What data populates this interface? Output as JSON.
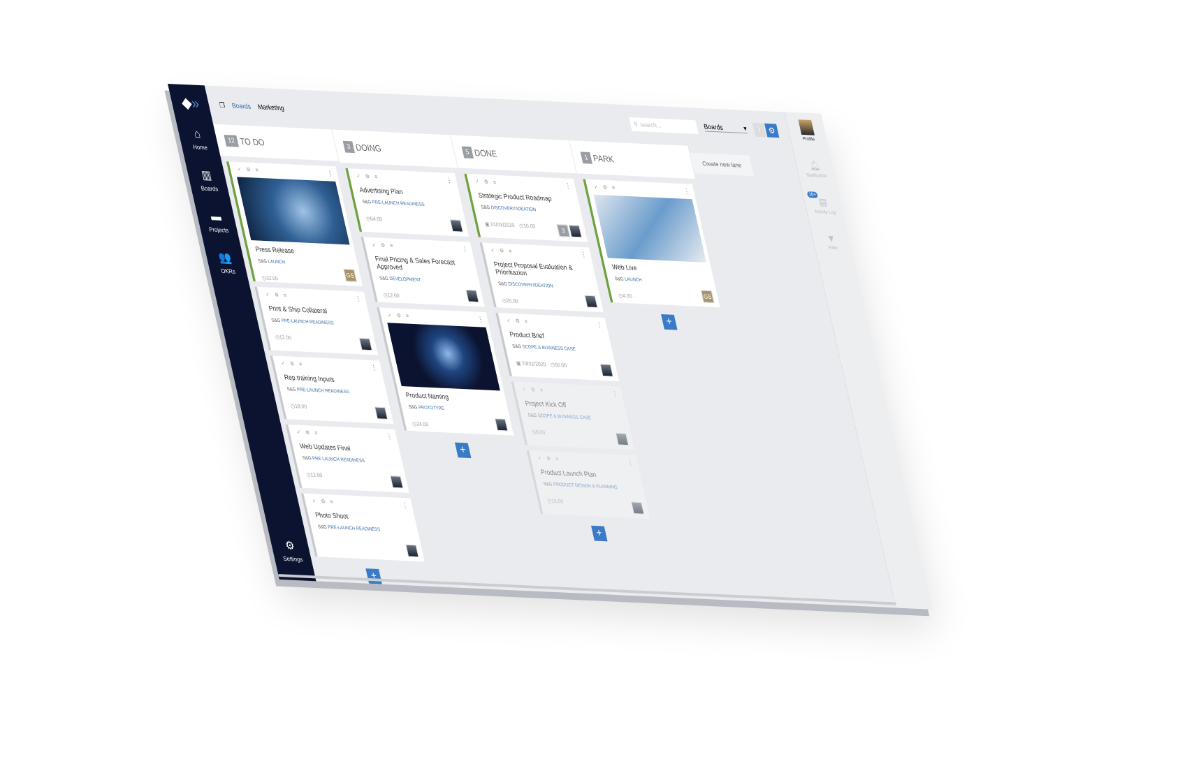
{
  "sidebar": {
    "items": [
      {
        "label": "Home",
        "icon": "home-icon"
      },
      {
        "label": "Boards",
        "icon": "boards-icon"
      },
      {
        "label": "Projects",
        "icon": "folder-icon"
      },
      {
        "label": "OKRs",
        "icon": "people-icon"
      }
    ],
    "settings": "Settings"
  },
  "breadcrumb": {
    "root": "Boards",
    "current": "Marketing"
  },
  "search": {
    "placeholder": "search..."
  },
  "board_select": {
    "value": "Boards"
  },
  "lanes": [
    {
      "count": "12",
      "name": "TO DO",
      "cards": [
        {
          "title": "Press Release",
          "prefix": "S&G",
          "tag": "LAUNCH",
          "time": "32.00",
          "avatar": "GS",
          "image": "tech",
          "green": true
        },
        {
          "title": "Print & Ship Collateral",
          "prefix": "S&G",
          "tag": "PRE-LAUNCH READINESS",
          "time": "12.00"
        },
        {
          "title": "Rep training Inputs",
          "prefix": "S&G",
          "tag": "PRE-LAUNCH READINESS",
          "time": "18.00"
        },
        {
          "title": "Web Updates Final",
          "prefix": "S&G",
          "tag": "PRE-LAUNCH READINESS",
          "time": "12.00"
        },
        {
          "title": "Photo Shoot",
          "prefix": "S&G",
          "tag": "PRE-LAUNCH READINESS",
          "time": ""
        }
      ]
    },
    {
      "count": "3",
      "name": "DOING",
      "cards": [
        {
          "title": "Advertising Plan",
          "prefix": "S&G",
          "tag": "PRE-LAUNCH READINESS",
          "time": "64.00",
          "green": true
        },
        {
          "title": "Final Pricing & Sales Forecast Approved",
          "prefix": "S&G",
          "tag": "DEVELOPMENT",
          "time": "12.00"
        },
        {
          "title": "Product Naming",
          "prefix": "S&G",
          "tag": "PROTOTYPE",
          "time": "24.00",
          "image": "butterfly"
        }
      ]
    },
    {
      "count": "5",
      "name": "DONE",
      "cards": [
        {
          "title": "Strategic Product Roadmap",
          "prefix": "S&G",
          "tag": "DISCOVERY/IDEATION",
          "date": "01/03/2020",
          "time": "10.00",
          "extra": "3",
          "green": true
        },
        {
          "title": "Project Proposal Evaluation & Prioritiazion",
          "prefix": "S&G",
          "tag": "DISCOVERY/IDEATION",
          "time": "20.00"
        },
        {
          "title": "Product Brief",
          "prefix": "S&G",
          "tag": "SCOPE & BUSINESS CASE",
          "date": "23/02/2020",
          "time": "50.00"
        },
        {
          "title": "Project Kick Off",
          "prefix": "S&G",
          "tag": "SCOPE & BUSINESS CASE",
          "time": "8.00",
          "faded": true
        },
        {
          "title": "Product Launch Plan",
          "prefix": "S&G",
          "tag": "PRODUCT DESIGN & PLANNING",
          "time": "16.00",
          "faded": true
        }
      ]
    },
    {
      "count": "1",
      "name": "PARK",
      "cards": [
        {
          "title": "Web Live",
          "prefix": "S&G",
          "tag": "LAUNCH",
          "time": "4.00",
          "avatar": "GS",
          "image": "devices",
          "green": true
        }
      ]
    }
  ],
  "create_lane": "Create new lane",
  "right_panel": {
    "profile": "Profile",
    "notification": "Notification",
    "activity": "Activity Log",
    "activity_badge": "10+",
    "filter": "Filter"
  },
  "colors": {
    "sidebar": "#0b1330",
    "accent": "#3a7bc8",
    "lane_bar": "#6ea13f"
  }
}
